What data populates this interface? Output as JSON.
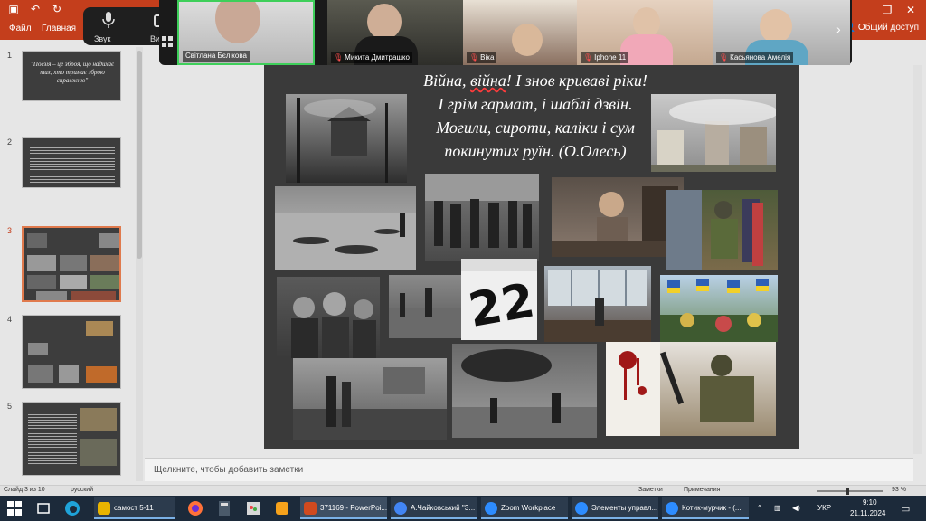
{
  "ribbon": {
    "tabs": [
      "Файл",
      "Главная"
    ],
    "share_label": "Общий доступ"
  },
  "zoom_controls": {
    "audio_label": "Звук",
    "video_label": "Ви"
  },
  "participants": [
    {
      "name": "Світлана Бєлікова",
      "muted": false
    },
    {
      "name": "Микита Дмитрашко",
      "muted": true
    },
    {
      "name": "Віка",
      "muted": true
    },
    {
      "name": "Iphone 11",
      "muted": true
    },
    {
      "name": "Касьянова Амелія",
      "muted": true
    }
  ],
  "thumbnails": [
    {
      "num": "1",
      "text": "\"Поезія – це зброя, що надихає тих, хто тримає зброю справжню\""
    },
    {
      "num": "2",
      "text": ""
    },
    {
      "num": "3",
      "text": ""
    },
    {
      "num": "4",
      "text": ""
    },
    {
      "num": "5",
      "text": ""
    }
  ],
  "slide": {
    "poem_lines": [
      {
        "before": "Війна, ",
        "squiggle": "війна",
        "after": "! І знов криваві ріки!"
      },
      {
        "before": "І грім гармат, і шаблі дзвін.",
        "squiggle": "",
        "after": ""
      },
      {
        "before": "Могили, сироти, каліки і сум",
        "squiggle": "",
        "after": ""
      },
      {
        "before": "покинутих руїн. (О.Олесь)",
        "squiggle": "",
        "after": ""
      }
    ]
  },
  "notes": {
    "placeholder": "Щелкните, чтобы добавить заметки"
  },
  "status": {
    "slide_info": "Слайд 3 из 10",
    "language": "русский",
    "notes_label": "Заметки",
    "comments_label": "Примечания",
    "zoom_level": "93 %"
  },
  "taskbar": {
    "apps": [
      {
        "label": "самост 5-11",
        "color": "#e8b400"
      },
      {
        "label": "371169 - PowerPoi...",
        "color": "#d04a1f"
      },
      {
        "label": "А.Чайковський \"З...",
        "color": "#4285f4"
      },
      {
        "label": "Zoom Workplace",
        "color": "#2d8cff"
      },
      {
        "label": "Элементы управл...",
        "color": "#2d8cff"
      },
      {
        "label": "Котик-мурчик - (...",
        "color": "#2d8cff"
      }
    ],
    "keyboard_lang": "УКР",
    "time": "9:10",
    "date": "21.11.2024"
  },
  "colors": {
    "ribbon": "#c43e1c",
    "slide_bg": "#3a3a3a",
    "taskbar": "#1c2a3a"
  }
}
